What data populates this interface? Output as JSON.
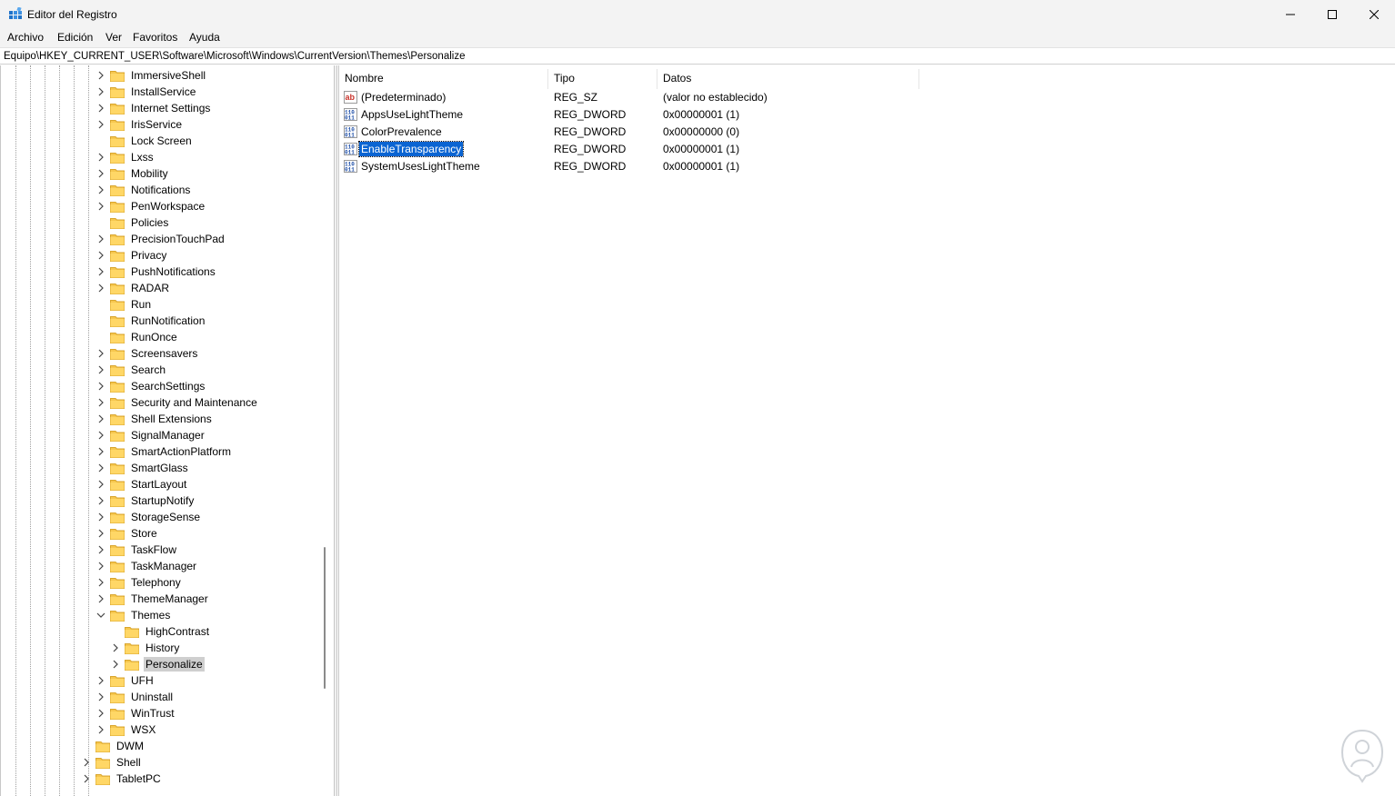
{
  "window": {
    "title": "Editor del Registro",
    "controls": {
      "minimize": "minimize",
      "maximize": "maximize",
      "close": "close"
    }
  },
  "menu": [
    "Archivo",
    "Edición",
    "Ver",
    "Favoritos",
    "Ayuda"
  ],
  "address": "Equipo\\HKEY_CURRENT_USER\\Software\\Microsoft\\Windows\\CurrentVersion\\Themes\\Personalize",
  "tree": {
    "items": [
      {
        "label": "ImmersiveShell",
        "expandable": true
      },
      {
        "label": "InstallService",
        "expandable": true
      },
      {
        "label": "Internet Settings",
        "expandable": true
      },
      {
        "label": "IrisService",
        "expandable": true
      },
      {
        "label": "Lock Screen",
        "expandable": false
      },
      {
        "label": "Lxss",
        "expandable": true
      },
      {
        "label": "Mobility",
        "expandable": true
      },
      {
        "label": "Notifications",
        "expandable": true
      },
      {
        "label": "PenWorkspace",
        "expandable": true
      },
      {
        "label": "Policies",
        "expandable": false
      },
      {
        "label": "PrecisionTouchPad",
        "expandable": true
      },
      {
        "label": "Privacy",
        "expandable": true
      },
      {
        "label": "PushNotifications",
        "expandable": true
      },
      {
        "label": "RADAR",
        "expandable": true
      },
      {
        "label": "Run",
        "expandable": false
      },
      {
        "label": "RunNotification",
        "expandable": false
      },
      {
        "label": "RunOnce",
        "expandable": false
      },
      {
        "label": "Screensavers",
        "expandable": true
      },
      {
        "label": "Search",
        "expandable": true
      },
      {
        "label": "SearchSettings",
        "expandable": true
      },
      {
        "label": "Security and Maintenance",
        "expandable": true
      },
      {
        "label": "Shell Extensions",
        "expandable": true
      },
      {
        "label": "SignalManager",
        "expandable": true
      },
      {
        "label": "SmartActionPlatform",
        "expandable": true
      },
      {
        "label": "SmartGlass",
        "expandable": true
      },
      {
        "label": "StartLayout",
        "expandable": true
      },
      {
        "label": "StartupNotify",
        "expandable": true
      },
      {
        "label": "StorageSense",
        "expandable": true
      },
      {
        "label": "Store",
        "expandable": true
      },
      {
        "label": "TaskFlow",
        "expandable": true
      },
      {
        "label": "TaskManager",
        "expandable": true
      },
      {
        "label": "Telephony",
        "expandable": true
      },
      {
        "label": "ThemeManager",
        "expandable": true
      },
      {
        "label": "Themes",
        "expanded": true
      },
      {
        "label": "HighContrast",
        "expandable": false,
        "child": true
      },
      {
        "label": "History",
        "expandable": true,
        "child": true
      },
      {
        "label": "Personalize",
        "expandable": true,
        "child": true,
        "selected": true
      },
      {
        "label": "UFH",
        "expandable": true
      },
      {
        "label": "Uninstall",
        "expandable": true
      },
      {
        "label": "WinTrust",
        "expandable": true
      },
      {
        "label": "WSX",
        "expandable": true
      },
      {
        "label": "DWM",
        "expandable": false,
        "parent_level": true
      },
      {
        "label": "Shell",
        "expandable": true,
        "parent_level": true
      },
      {
        "label": "TabletPC",
        "expandable": true,
        "parent_level": true
      }
    ]
  },
  "columns": {
    "name": "Nombre",
    "type": "Tipo",
    "data": "Datos"
  },
  "values": [
    {
      "name": "(Predeterminado)",
      "type": "REG_SZ",
      "data": "(valor no establecido)",
      "icon": "string-value-icon"
    },
    {
      "name": "AppsUseLightTheme",
      "type": "REG_DWORD",
      "data": "0x00000001 (1)",
      "icon": "dword-value-icon"
    },
    {
      "name": "ColorPrevalence",
      "type": "REG_DWORD",
      "data": "0x00000000 (0)",
      "icon": "dword-value-icon"
    },
    {
      "name": "EnableTransparency",
      "type": "REG_DWORD",
      "data": "0x00000001 (1)",
      "icon": "dword-value-icon",
      "selected": true
    },
    {
      "name": "SystemUsesLightTheme",
      "type": "REG_DWORD",
      "data": "0x00000001 (1)",
      "icon": "dword-value-icon"
    }
  ],
  "colors": {
    "selection": "#0a64d2",
    "folder": "#f6c74f",
    "tree_selected": "#cfcfcf"
  }
}
